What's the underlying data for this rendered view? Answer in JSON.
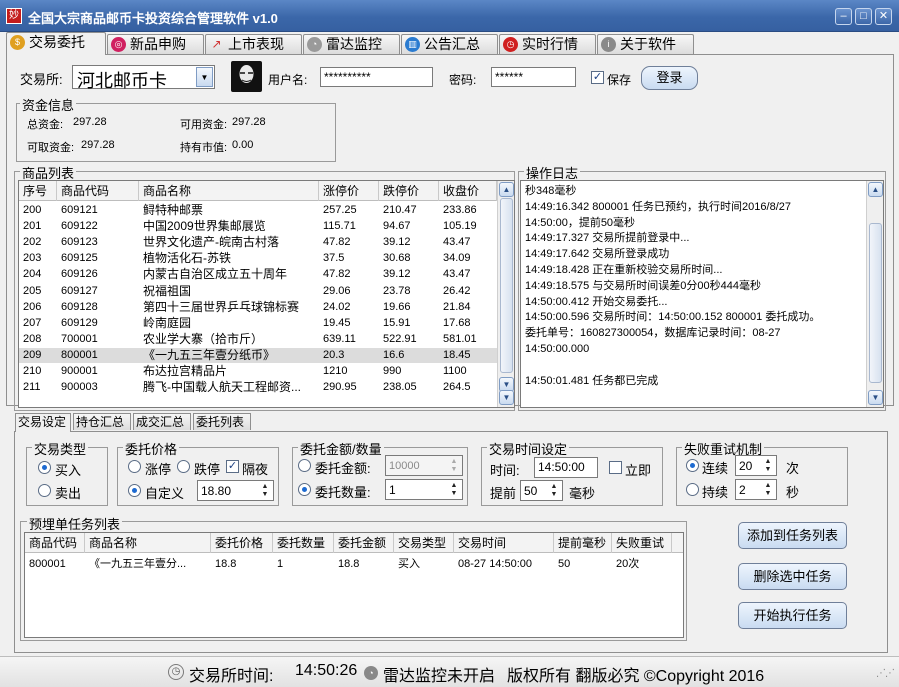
{
  "window": {
    "title": "全国大宗商品邮币卡投资综合管理软件 v1.0",
    "icon_text": "妙",
    "controls": [
      "minimize",
      "maximize",
      "close"
    ]
  },
  "main_tabs": [
    {
      "label": "交易委托",
      "icon": "coin-icon",
      "color": "#e0a020"
    },
    {
      "label": "新品申购",
      "icon": "lifebuoy-icon",
      "color": "#d02060"
    },
    {
      "label": "上市表现",
      "icon": "line-chart-icon",
      "color": "#d03030"
    },
    {
      "label": "雷达监控",
      "icon": "radar-icon",
      "color": "#707070"
    },
    {
      "label": "公告汇总",
      "icon": "bar-chart-icon",
      "color": "#2a7bd0"
    },
    {
      "label": "实时行情",
      "icon": "clock-icon",
      "color": "#d02020"
    },
    {
      "label": "关于软件",
      "icon": "info-icon",
      "color": "#8a8a8a"
    }
  ],
  "login": {
    "exchange_label": "交易所:",
    "exchange_value": "河北邮币卡",
    "username_label": "用户名:",
    "username_value": "**********",
    "password_label": "密码:",
    "password_value": "******",
    "save_label": "保存",
    "save_checked": true,
    "login_button": "登录"
  },
  "funds": {
    "title": "资金信息",
    "total_label": "总资金:",
    "total_value": "297.28",
    "available_label": "可用资金:",
    "available_value": "297.28",
    "withdrawable_label": "可取资金:",
    "withdrawable_value": "297.28",
    "market_value_label": "持有市值:",
    "market_value_value": "0.00"
  },
  "products": {
    "title": "商品列表",
    "columns": [
      "序号",
      "商品代码",
      "商品名称",
      "涨停价",
      "跌停价",
      "收盘价"
    ],
    "rows": [
      [
        "200",
        "609121",
        "鲟特种邮票",
        "257.25",
        "210.47",
        "233.86"
      ],
      [
        "201",
        "609122",
        "中国2009世界集邮展览",
        "115.71",
        "94.67",
        "105.19"
      ],
      [
        "202",
        "609123",
        "世界文化遗产-皖南古村落",
        "47.82",
        "39.12",
        "43.47"
      ],
      [
        "203",
        "609125",
        "植物活化石-苏铁",
        "37.5",
        "30.68",
        "34.09"
      ],
      [
        "204",
        "609126",
        "内蒙古自治区成立五十周年",
        "47.82",
        "39.12",
        "43.47"
      ],
      [
        "205",
        "609127",
        "祝福祖国",
        "29.06",
        "23.78",
        "26.42"
      ],
      [
        "206",
        "609128",
        "第四十三届世界乒乓球锦标赛",
        "24.02",
        "19.66",
        "21.84"
      ],
      [
        "207",
        "609129",
        "岭南庭园",
        "19.45",
        "15.91",
        "17.68"
      ],
      [
        "208",
        "700001",
        "农业学大寨（拾市斤）",
        "639.11",
        "522.91",
        "581.01"
      ],
      [
        "209",
        "800001",
        "《一九五三年壹分纸币》",
        "20.3",
        "16.6",
        "18.45"
      ],
      [
        "210",
        "900001",
        "布达拉宫精品片",
        "1210",
        "990",
        "1100"
      ],
      [
        "211",
        "900003",
        "腾飞-中国载人航天工程邮资...",
        "290.95",
        "238.05",
        "264.5"
      ]
    ],
    "selected_index": 9
  },
  "log": {
    "title": "操作日志",
    "lines": [
      "秒348毫秒",
      "14:49:16.342 800001 任务已预约，执行时间2016/8/27",
      "14:50:00，提前50毫秒",
      "14:49:17.327 交易所提前登录中...",
      "14:49:17.642 交易所登录成功",
      "14:49:18.428 正在重新校验交易所时间...",
      "14:49:18.575 与交易所时间误差0分00秒444毫秒",
      "14:50:00.412 开始交易委托...",
      "14:50:00.596 交易所时间：14:50:00.152 800001 委托成功。",
      "委托单号：160827300054，数据库记录时间：08-27",
      "14:50:00.000",
      "",
      "14:50:01.481 任务都已完成"
    ]
  },
  "sub_tabs": [
    "交易设定",
    "持仓汇总",
    "成交汇总",
    "委托列表"
  ],
  "trade_type": {
    "title": "交易类型",
    "buy": "买入",
    "sell": "卖出",
    "selected": "buy"
  },
  "order_price": {
    "title": "委托价格",
    "limit_up": "涨停",
    "limit_down": "跌停",
    "overnight": "隔夜",
    "overnight_checked": true,
    "custom": "自定义",
    "custom_value": "18.80",
    "selected": "custom"
  },
  "order_amount": {
    "title": "委托金额/数量",
    "amount_label": "委托金额:",
    "amount_value": "10000",
    "qty_label": "委托数量:",
    "qty_value": "1",
    "selected": "qty"
  },
  "trade_time": {
    "title": "交易时间设定",
    "time_label": "时间:",
    "time_value": "14:50:00",
    "immediate_label": "立即",
    "immediate_checked": false,
    "advance_label": "提前",
    "advance_value": "50",
    "advance_unit": "毫秒"
  },
  "retry": {
    "title": "失败重试机制",
    "continuous_label": "连续",
    "continuous_value": "20",
    "continuous_unit": "次",
    "sustained_label": "持续",
    "sustained_value": "2",
    "sustained_unit": "秒",
    "selected": "continuous"
  },
  "task_list": {
    "title": "预埋单任务列表",
    "columns": [
      "商品代码",
      "商品名称",
      "委托价格",
      "委托数量",
      "委托金额",
      "交易类型",
      "交易时间",
      "提前毫秒",
      "失败重试"
    ],
    "rows": [
      [
        "800001",
        "《一九五三年壹分...",
        "18.8",
        "1",
        "18.8",
        "买入",
        "08-27 14:50:00",
        "50",
        "20次"
      ]
    ]
  },
  "actions": {
    "add": "添加到任务列表",
    "delete": "删除选中任务",
    "start": "开始执行任务"
  },
  "status": {
    "time_label": "交易所时间:",
    "time_value": "14:50:26",
    "radar_status": "雷达监控未开启",
    "copyright": "版权所有 翻版必究 ©Copyright 2016"
  }
}
